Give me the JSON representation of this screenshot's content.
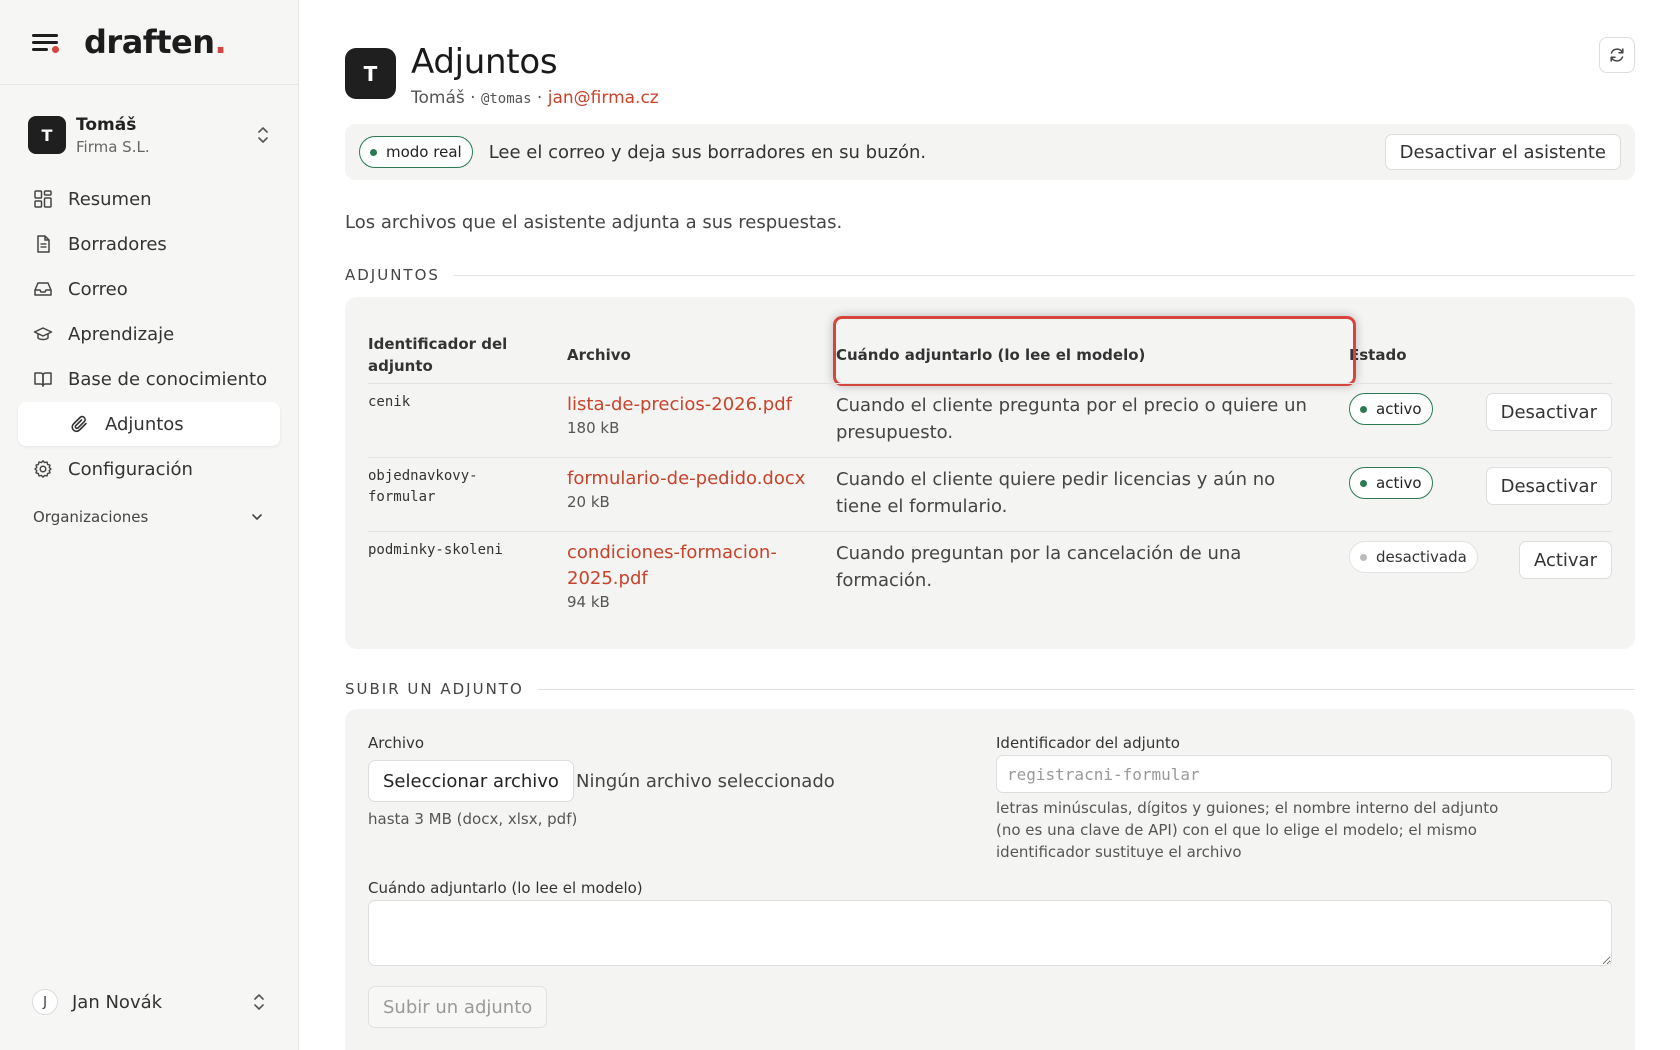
{
  "brand": {
    "name": "draften",
    "dot": "."
  },
  "org": {
    "initial": "T",
    "name": "Tomáš",
    "company": "Firma S.L."
  },
  "nav": {
    "items": [
      {
        "label": "Resumen",
        "icon": "dashboard-icon"
      },
      {
        "label": "Borradores",
        "icon": "document-icon"
      },
      {
        "label": "Correo",
        "icon": "inbox-icon"
      },
      {
        "label": "Aprendizaje",
        "icon": "graduation-cap-icon"
      },
      {
        "label": "Base de conocimiento",
        "icon": "book-icon"
      },
      {
        "label": "Adjuntos",
        "icon": "paperclip-icon"
      },
      {
        "label": "Configuración",
        "icon": "gear-icon"
      }
    ],
    "section": "Organizaciones"
  },
  "user": {
    "initial": "J",
    "name": "Jan Novák"
  },
  "page": {
    "avatar_initial": "T",
    "title": "Adjuntos",
    "meta_name": "Tomáš",
    "separator": " · ",
    "handle": "@tomas",
    "email": "jan@firma.cz"
  },
  "mode": {
    "pill": "modo real",
    "text": "Lee el correo y deja sus borradores en su buzón.",
    "button": "Desactivar el asistente"
  },
  "intro": "Los archivos que el asistente adjunta a sus respuestas.",
  "attachments": {
    "section_label": "ADJUNTOS",
    "headers": {
      "id": "Identificador del adjunto",
      "file": "Archivo",
      "when": "Cuándo adjuntarlo (lo lee el modelo)",
      "state": "Estado"
    },
    "rows": [
      {
        "id": "cenik",
        "file": "lista-de-precios-2026.pdf",
        "size": "180 kB",
        "when": "Cuando el cliente pregunta por el precio o quiere un presupuesto.",
        "state": "activo",
        "action": "Desactivar"
      },
      {
        "id": "objednavkovy-formular",
        "file": "formulario-de-pedido.docx",
        "size": "20 kB",
        "when": "Cuando el cliente quiere pedir licencias y aún no tiene el formulario.",
        "state": "activo",
        "action": "Desactivar"
      },
      {
        "id": "podminky-skoleni",
        "file": "condiciones-formacion-2025.pdf",
        "size": "94 kB",
        "when": "Cuando preguntan por la cancelación de una formación.",
        "state": "desactivada",
        "action": "Activar"
      }
    ]
  },
  "upload": {
    "section_label": "SUBIR UN ADJUNTO",
    "file_label": "Archivo",
    "file_button": "Seleccionar archivo",
    "no_file": "Ningún archivo seleccionado",
    "file_hint": "hasta 3 MB (docx, xlsx, pdf)",
    "id_label": "Identificador del adjunto",
    "id_placeholder": "registracni-formular",
    "id_hint": "letras minúsculas, dígitos y guiones; el nombre interno del adjunto (no es una clave de API) con el que lo elige el modelo; el mismo identificador sustituye el archivo",
    "when_label": "Cuándo adjuntarlo (lo lee el modelo)",
    "submit": "Subir un adjunto"
  },
  "colors": {
    "accent": "#c8432b",
    "active_green": "#2c7a52",
    "highlight": "#d6453d"
  }
}
